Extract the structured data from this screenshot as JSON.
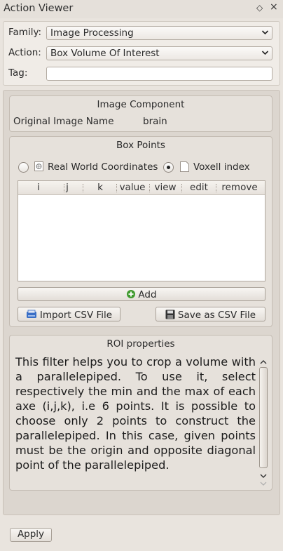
{
  "window": {
    "title": "Action Viewer",
    "float_glyph": "◇",
    "close_glyph": "×"
  },
  "form": {
    "family_label": "Family:",
    "family_value": "Image Processing",
    "action_label": "Action:",
    "action_value": "Box Volume Of Interest",
    "tag_label": "Tag:",
    "tag_value": "",
    "dropdown_glyph": "⌄"
  },
  "image_component": {
    "title": "Image Component",
    "original_image_label": "Original Image Name",
    "original_image_value": "brain"
  },
  "box_points": {
    "title": "Box Points",
    "coord_option_1": "Real World Coordinates",
    "coord_option_2": "Voxell index",
    "selected_option": "Voxell index",
    "columns": [
      "i",
      "j",
      "k",
      "value",
      "view",
      "edit",
      "remove"
    ],
    "rows": [],
    "add_label": "Add",
    "import_label": "Import CSV File",
    "save_label": "Save as CSV File"
  },
  "roi": {
    "title": "ROI properties",
    "description": "This filter helps you to crop a volume with a parallelepiped. To use it, select respectively the min and the max of each axe (i,j,k), i.e 6 points. It is possible to choose only 2 points to construct the parallelepiped. In this case, given points must be the origin and opposite diagonal point of the parallelepiped."
  },
  "footer": {
    "apply_label": "Apply"
  },
  "colors": {
    "background": "#e9e4de",
    "panel": "#e6e1db",
    "add_icon": "#3f9a2e",
    "import_icon": "#3a6fc6",
    "save_icon": "#333333"
  }
}
